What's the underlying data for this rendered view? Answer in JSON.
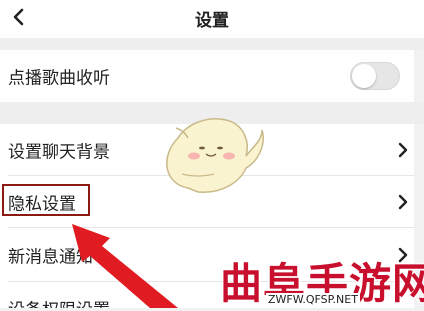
{
  "header": {
    "title": "设置"
  },
  "rows": [
    {
      "label": "点播歌曲收听",
      "control": "toggle",
      "toggle_on": false
    },
    {
      "label": "设置聊天背景",
      "control": "chevron"
    },
    {
      "label": "隐私设置",
      "control": "chevron",
      "highlighted": true
    },
    {
      "label": "新消息通知",
      "control": "chevron"
    },
    {
      "label": "设备权限设置",
      "control": "chevron"
    }
  ],
  "icons": {
    "back": "back-chevron-icon",
    "chevron": "chevron-right-icon",
    "mascot": "mascot-sticker",
    "arrow": "red-pointer-arrow"
  },
  "colors": {
    "highlight_border": "#8b1a14",
    "arrow": "#e11b22",
    "watermark": "#c8102e"
  },
  "watermark": {
    "main": "曲阜手游网",
    "sub": "ZWFW.QFSP.NET"
  }
}
